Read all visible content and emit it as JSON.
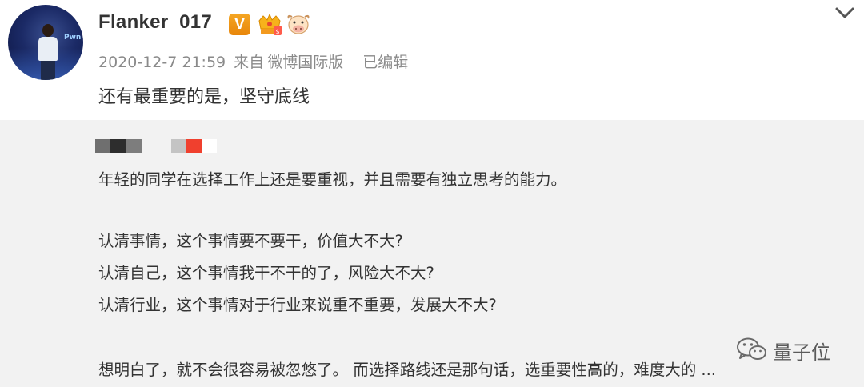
{
  "post": {
    "username": "Flanker_017",
    "verified_badge": "V",
    "timestamp": "2020-12-7 21:59",
    "source_prefix": "来自",
    "source": "微博国际版",
    "edited": "已编辑",
    "text": "还有最重要的是，坚守底线"
  },
  "quoted": {
    "lines": [
      "年轻的同学在选择工作上还是要重视，并且需要有独立思考的能力。",
      "认清事情，这个事情要不要干，价值大不大?",
      "认清自己，这个事情我干不干的了，风险大不大?",
      "认清行业，这个事情对于行业来说重不重要，发展大不大?",
      "想明白了，就不会很容易被忽悠了。 而选择路线还是那句话，选重要性高的，难度大的 ..."
    ]
  },
  "watermark": {
    "text": "量子位"
  },
  "icons": {
    "avatar": "user-avatar",
    "verified": "verified-v-icon",
    "crown": "crown-badge-icon",
    "bull": "bull-badge-icon",
    "menu": "chevron-down-icon",
    "wechat": "wechat-icon"
  },
  "colors": {
    "verified_badge": "#f5a623",
    "meta_text": "#8a8a8a",
    "quote_background": "#f2f2f2"
  }
}
